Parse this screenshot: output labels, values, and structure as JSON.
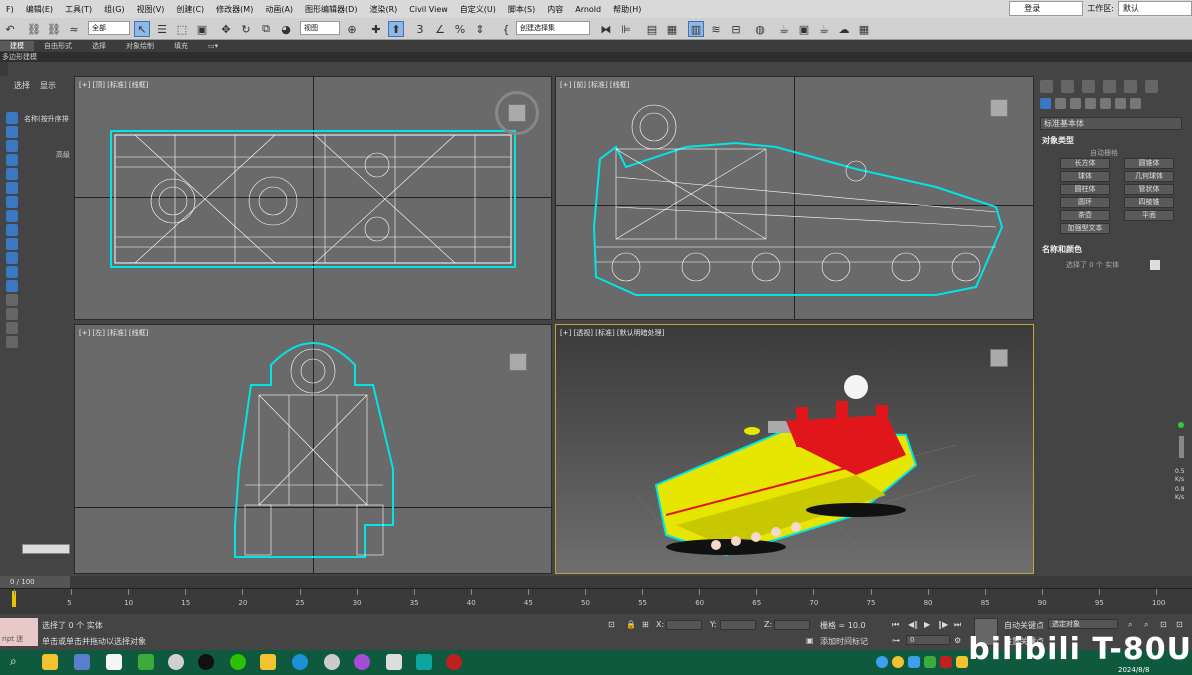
{
  "menu": [
    "F)",
    "编辑(E)",
    "工具(T)",
    "组(G)",
    "视图(V)",
    "创建(C)",
    "修改器(M)",
    "动画(A)",
    "图形编辑器(D)",
    "渲染(R)",
    "Civil View",
    "自定义(U)",
    "脚本(S)",
    "内容",
    "Arnold",
    "帮助(H)"
  ],
  "account": {
    "login": "登录",
    "workspace_label": "工作区:",
    "workspace_value": "默认"
  },
  "toolbar": {
    "filter": "全部",
    "ref_coord": "视图",
    "selection_set": "创建选择集"
  },
  "ribbon": {
    "tabs": [
      "建模",
      "自由形式",
      "选择",
      "对象绘制",
      "填充"
    ],
    "subtitle": "多边形建模"
  },
  "scene_explorer": {
    "tabs": [
      "选择",
      "显示"
    ],
    "header": "名称(按升序排",
    "rows": [
      "高级"
    ]
  },
  "viewports": [
    {
      "label": "[+] [顶] [标准] [线框]"
    },
    {
      "label": "[+] [前] [标准] [线框]"
    },
    {
      "label": "[+] [左] [标准] [线框]"
    },
    {
      "label": "[+] [透视] [标准] [默认明暗处理]"
    }
  ],
  "command_panel": {
    "category": "标准基本体",
    "object_type_title": "对象类型",
    "autogrid": "自动栅格",
    "buttons": [
      "长方体",
      "圆锥体",
      "球体",
      "几何球体",
      "圆柱体",
      "管状体",
      "圆环",
      "四棱锥",
      "茶壶",
      "平面",
      "加强型文本"
    ],
    "name_color_title": "名称和颜色",
    "selected_text": "选择了 0 个 实体"
  },
  "side_meter": {
    "v1": "0.5",
    "u1": "K/s",
    "v2": "0.8",
    "u2": "K/s"
  },
  "timeline": {
    "counter": "0 / 100",
    "ticks": [
      "0",
      "5",
      "10",
      "15",
      "20",
      "25",
      "30",
      "35",
      "40",
      "45",
      "50",
      "55",
      "60",
      "65",
      "70",
      "75",
      "80",
      "85",
      "90",
      "95",
      "100"
    ]
  },
  "status": {
    "maxscript": "ript 迷",
    "selected": "选择了 0 个 实体",
    "hint": "单击或单击并拖动以选择对象",
    "x_label": "X:",
    "y_label": "Y:",
    "z_label": "Z:",
    "grid": "栅格 = 10.0",
    "add_time_tag": "添加时间标记",
    "auto_key": "自动关键点",
    "set_key": "设置关键点",
    "selected_object": "选定对象",
    "frame": "0"
  },
  "watermark": "bilibili T-80U",
  "date": "2024/8/8",
  "colors": {
    "menubar": "#d9d9d9",
    "viewport": "#6a6a6a",
    "wire": "#ffffff",
    "select_outline": "#00e5e5",
    "model_yellow": "#e6e600",
    "model_red": "#e0161a",
    "taskbar": "#0f5a3e",
    "active_frame": "#c6a23a"
  }
}
